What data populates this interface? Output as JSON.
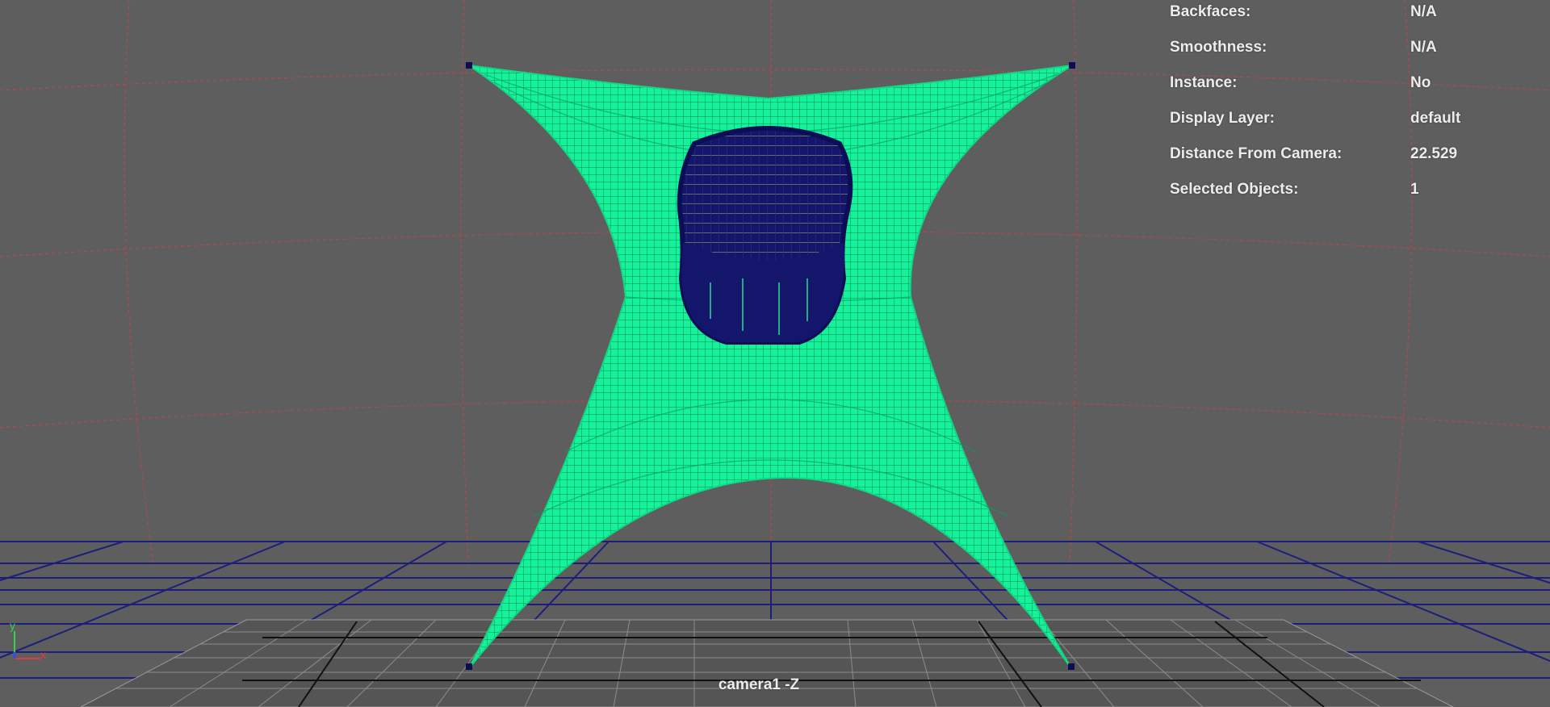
{
  "hud": {
    "rows": [
      {
        "label": "Backfaces:",
        "value": "N/A"
      },
      {
        "label": "Smoothness:",
        "value": "N/A"
      },
      {
        "label": "Instance:",
        "value": "No"
      },
      {
        "label": "Display Layer:",
        "value": "default"
      },
      {
        "label": "Distance From Camera:",
        "value": "22.529"
      },
      {
        "label": "Selected Objects:",
        "value": "1"
      }
    ]
  },
  "viewport": {
    "camera_label": "camera1 -Z"
  },
  "axis": {
    "y_label": "y",
    "x_label": "x"
  },
  "colors": {
    "background": "#5e5e5e",
    "cloth_mesh": "#13f296",
    "selected_object": "#13156a",
    "ground_grid": "#1c1f7a",
    "reference_grid": "#b8474a",
    "text": "#ececec"
  }
}
